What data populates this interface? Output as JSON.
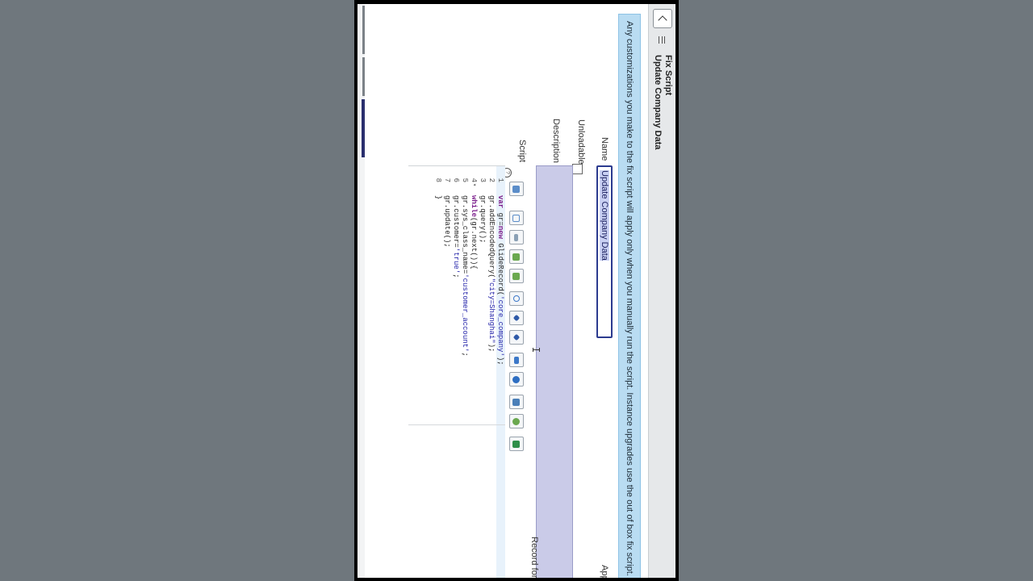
{
  "header": {
    "record_type": "Fix Script",
    "record_name": "Update Company Data"
  },
  "banner": {
    "text": "Any customizations you make to the fix script will apply only when you manually run the script. Instance upgrades use the out of box fix script."
  },
  "form": {
    "name_label": "Name",
    "name_value": "Update Company Data",
    "unloadable_label": "Unloadable",
    "description_label": "Description",
    "script_label": "Script",
    "record_label": "Record for r",
    "app_label": "App"
  },
  "toolbar": {
    "buttons": [
      "toggle-syntax-icon",
      "comment-icon",
      "format-icon",
      "indent-icon",
      "replace-icon",
      "search-icon",
      "find-next-icon",
      "find-prev-icon",
      "fullscreen-icon",
      "script-debugger-icon",
      "save-icon",
      "script-include-icon",
      "run-icon"
    ]
  },
  "script": {
    "lines": [
      {
        "n": "1",
        "fold": "",
        "text": "var gr=new GlideRecord('core_company');"
      },
      {
        "n": "2",
        "fold": "",
        "text": "gr.addEncodedQuery(\"city=Shanghai\");"
      },
      {
        "n": "3",
        "fold": "",
        "text": "gr.query();"
      },
      {
        "n": "4",
        "fold": "▾",
        "text": "while(gr.next()){"
      },
      {
        "n": "5",
        "fold": "",
        "text": "gr.sys_class_name='customer_account';"
      },
      {
        "n": "6",
        "fold": "",
        "text": "gr.customer='true';"
      },
      {
        "n": "7",
        "fold": "",
        "text": "gr.update();"
      },
      {
        "n": "8",
        "fold": "",
        "text": "}"
      }
    ]
  },
  "colors": {
    "banner_bg": "#b9dcf2",
    "input_border": "#2c3b8f",
    "description_bg": "#cacbe8",
    "keyword": "#7a1b8a",
    "string": "#1a1aa6"
  }
}
